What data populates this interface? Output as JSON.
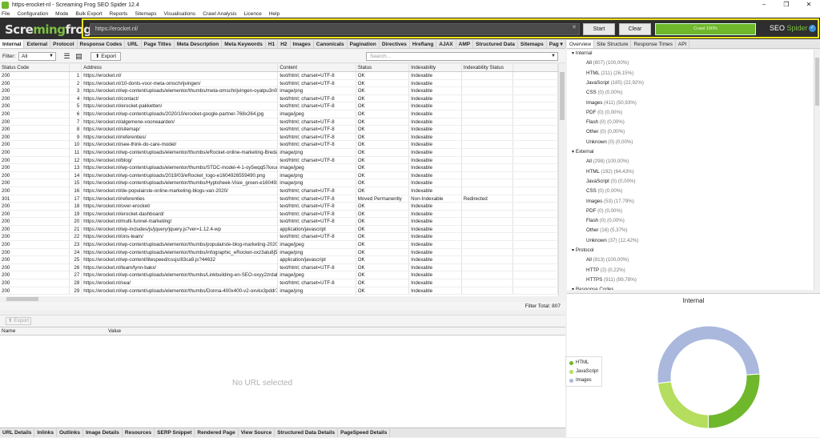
{
  "window": {
    "title": "https-erocket-nl - Screaming Frog SEO Spider 12.4",
    "controls": [
      "–",
      "❐",
      "✕"
    ]
  },
  "menu": [
    "File",
    "Configuration",
    "Mode",
    "Bulk Export",
    "Reports",
    "Sitemaps",
    "Visualisations",
    "Crawl Analysis",
    "Licence",
    "Help"
  ],
  "header": {
    "logo_a": "Scre",
    "logo_b": "ming",
    "logo_c": "frog",
    "url": "https://erocket.nl/",
    "clear_x": "✕",
    "start_label": "Start",
    "clear_label": "Clear",
    "progress_label": "Crawl 100%",
    "progress": 1.0,
    "brand_a": "SEO ",
    "brand_b": "Spider",
    "highlight_color": "#f1e31a",
    "accent": "#6fb72b"
  },
  "tabs": [
    "Internal",
    "External",
    "Protocol",
    "Response Codes",
    "URL",
    "Page Titles",
    "Meta Description",
    "Meta Keywords",
    "H1",
    "H2",
    "Images",
    "Canonicals",
    "Pagination",
    "Directives",
    "Hreflang",
    "AJAX",
    "AMP",
    "Structured Data",
    "Sitemaps",
    "Pag ▾"
  ],
  "right_tabs": [
    "Overview",
    "Site Structure",
    "Response Times",
    "API"
  ],
  "filter": {
    "label": "Filter:",
    "value": "All",
    "export_label": "Export",
    "search_placeholder": "Search..."
  },
  "grid": {
    "columns": [
      "Status Code",
      "",
      "Address",
      "Content",
      "Status",
      "Indexability",
      "Indexability Status",
      ""
    ],
    "rows": [
      [
        "200",
        "1",
        "https://erocket.nl/",
        "text/html; charset=UTF-8",
        "OK",
        "Indexable",
        ""
      ],
      [
        "200",
        "2",
        "https://erocket.nl/10-donts-voor-meta-omschrijvingen/",
        "text/html; charset=UTF-8",
        "OK",
        "Indexable",
        ""
      ],
      [
        "200",
        "3",
        "https://erocket.nl/wp-content/uploads/elementor/thumbs/meta-omschrijvingen-oyatpu3n0vf...",
        "image/png",
        "OK",
        "Indexable",
        ""
      ],
      [
        "200",
        "4",
        "https://erocket.nl/contact/",
        "text/html; charset=UTF-8",
        "OK",
        "Indexable",
        ""
      ],
      [
        "200",
        "5",
        "https://erocket.nl/erocket-pakketten/",
        "text/html; charset=UTF-8",
        "OK",
        "Indexable",
        ""
      ],
      [
        "200",
        "6",
        "https://erocket.nl/wp-content/uploads/2020/10/erocket-google-partner-768x264.jpg",
        "image/jpeg",
        "OK",
        "Indexable",
        ""
      ],
      [
        "200",
        "7",
        "https://erocket.nl/algemene-voorwaarden/",
        "text/html; charset=UTF-8",
        "OK",
        "Indexable",
        ""
      ],
      [
        "200",
        "8",
        "https://erocket.nl/sitemap/",
        "text/html; charset=UTF-8",
        "OK",
        "Indexable",
        ""
      ],
      [
        "200",
        "9",
        "https://erocket.nl/referenties/",
        "text/html; charset=UTF-8",
        "OK",
        "Indexable",
        ""
      ],
      [
        "200",
        "10",
        "https://erocket.nl/see-think-do-care-model/",
        "text/html; charset=UTF-8",
        "OK",
        "Indexable",
        ""
      ],
      [
        "200",
        "11",
        "https://erocket.nl/wp-content/uploads/elementor/thumbs/eRocket-online-marketing-Breda-...",
        "image/png",
        "OK",
        "Indexable",
        ""
      ],
      [
        "200",
        "12",
        "https://erocket.nl/blog/",
        "text/html; charset=UTF-8",
        "OK",
        "Indexable",
        ""
      ],
      [
        "200",
        "13",
        "https://erocket.nl/wp-content/uploads/elementor/thumbs/STDC-model-4-1-oy5wqq57kxuq7...",
        "image/jpeg",
        "OK",
        "Indexable",
        ""
      ],
      [
        "200",
        "14",
        "https://erocket.nl/wp-content/uploads/2019/03/eRocket_logo-e1604926559490.png",
        "image/png",
        "OK",
        "Indexable",
        ""
      ],
      [
        "200",
        "15",
        "https://erocket.nl/wp-content/uploads/elementor/thumbs/Hyptoheek-Visie_groen-e1604926...",
        "image/png",
        "OK",
        "Indexable",
        ""
      ],
      [
        "200",
        "16",
        "https://erocket.nl/de-populairste-online-marketing-blogs-van-2020/",
        "text/html; charset=UTF-8",
        "OK",
        "Indexable",
        ""
      ],
      [
        "301",
        "17",
        "https://erocket.nl/referenties",
        "text/html; charset=UTF-8",
        "Moved Permanently",
        "Non-Indexable",
        "Redirected"
      ],
      [
        "200",
        "18",
        "https://erocket.nl/over-erocket/",
        "text/html; charset=UTF-8",
        "OK",
        "Indexable",
        ""
      ],
      [
        "200",
        "19",
        "https://erocket.nl/erocket-dashboard/",
        "text/html; charset=UTF-8",
        "OK",
        "Indexable",
        ""
      ],
      [
        "200",
        "20",
        "https://erocket.nl/multi-funnel-marketing/",
        "text/html; charset=UTF-8",
        "OK",
        "Indexable",
        ""
      ],
      [
        "200",
        "21",
        "https://erocket.nl/wp-includes/js/jquery/jquery.js?ver=1.12.4-wp",
        "application/javascript",
        "OK",
        "Indexable",
        ""
      ],
      [
        "200",
        "22",
        "https://erocket.nl/ons-team/",
        "text/html; charset=UTF-8",
        "OK",
        "Indexable",
        ""
      ],
      [
        "200",
        "23",
        "https://erocket.nl/wp-content/uploads/elementor/thumbs/populairste-blog-marketing-2020-...",
        "image/jpeg",
        "OK",
        "Indexable",
        ""
      ],
      [
        "200",
        "24",
        "https://erocket.nl/wp-content/uploads/elementor/thumbs/infographic_eRocket-oxz3atu8j5h...",
        "image/png",
        "OK",
        "Indexable",
        ""
      ],
      [
        "200",
        "25",
        "https://erocket.nl/wp-content/litespeed/cssjs/83ca9.js?44632",
        "application/javascript",
        "OK",
        "Indexable",
        ""
      ],
      [
        "200",
        "26",
        "https://erocket.nl/team/lynn-bakx/",
        "text/html; charset=UTF-8",
        "OK",
        "Indexable",
        ""
      ],
      [
        "200",
        "27",
        "https://erocket.nl/wp-content/uploads/elementor/thumbs/Linkbuilding-en-SEO-oxyy2zrdah1...",
        "image/jpeg",
        "OK",
        "Indexable",
        ""
      ],
      [
        "200",
        "28",
        "https://erocket.nl/sea/",
        "text/html; charset=UTF-8",
        "OK",
        "Indexable",
        ""
      ],
      [
        "200",
        "29",
        "https://erocket.nl/wp-content/uploads/elementor/thumbs/Donna-400x400-v2-oxvkx3pddr79...",
        "image/png",
        "OK",
        "Indexable",
        ""
      ]
    ]
  },
  "filter_total": "Filter Total:  807",
  "lower": {
    "export_label": "Export",
    "col_name": "Name",
    "col_value": "Value",
    "empty_text": "No URL selected"
  },
  "bottom_tabs": [
    "URL Details",
    "Inlinks",
    "Outlinks",
    "Image Details",
    "Resources",
    "SERP Snippet",
    "Rendered Page",
    "View Source",
    "Structured Data Details",
    "PageSpeed Details"
  ],
  "overview": {
    "sections": [
      {
        "title": "Internal",
        "items": [
          [
            "All",
            "(807) (100,00%)"
          ],
          [
            "HTML",
            "(211) (26,15%)"
          ],
          [
            "JavaScript",
            "(185) (22,92%)"
          ],
          [
            "CSS",
            "(0) (0,00%)"
          ],
          [
            "Images",
            "(411) (50,93%)"
          ],
          [
            "PDF",
            "(0) (0,00%)"
          ],
          [
            "Flash",
            "(0) (0,00%)"
          ],
          [
            "Other",
            "(0) (0,00%)"
          ],
          [
            "Unknown",
            "(0) (0,00%)"
          ]
        ]
      },
      {
        "title": "External",
        "items": [
          [
            "All",
            "(298) (100,00%)"
          ],
          [
            "HTML",
            "(192) (64,43%)"
          ],
          [
            "JavaScript",
            "(0) (0,00%)"
          ],
          [
            "CSS",
            "(0) (0,00%)"
          ],
          [
            "Images",
            "(53) (17,79%)"
          ],
          [
            "PDF",
            "(0) (0,00%)"
          ],
          [
            "Flash",
            "(0) (0,00%)"
          ],
          [
            "Other",
            "(16) (5,37%)"
          ],
          [
            "Unknown",
            "(37) (12,42%)"
          ]
        ]
      },
      {
        "title": "Protocol",
        "items": [
          [
            "All",
            "(913) (100,00%)"
          ],
          [
            "HTTP",
            "(2) (0,22%)"
          ],
          [
            "HTTPS",
            "(911) (99,78%)"
          ]
        ]
      },
      {
        "title": "Response Codes",
        "items": []
      }
    ]
  },
  "chart_data": {
    "type": "pie",
    "title": "Internal",
    "categories": [
      "HTML",
      "JavaScript",
      "Images"
    ],
    "values": [
      211,
      185,
      411
    ],
    "colors": [
      "#6fb72b",
      "#b5dd5e",
      "#a9b8dc"
    ],
    "legend_position": "left"
  }
}
